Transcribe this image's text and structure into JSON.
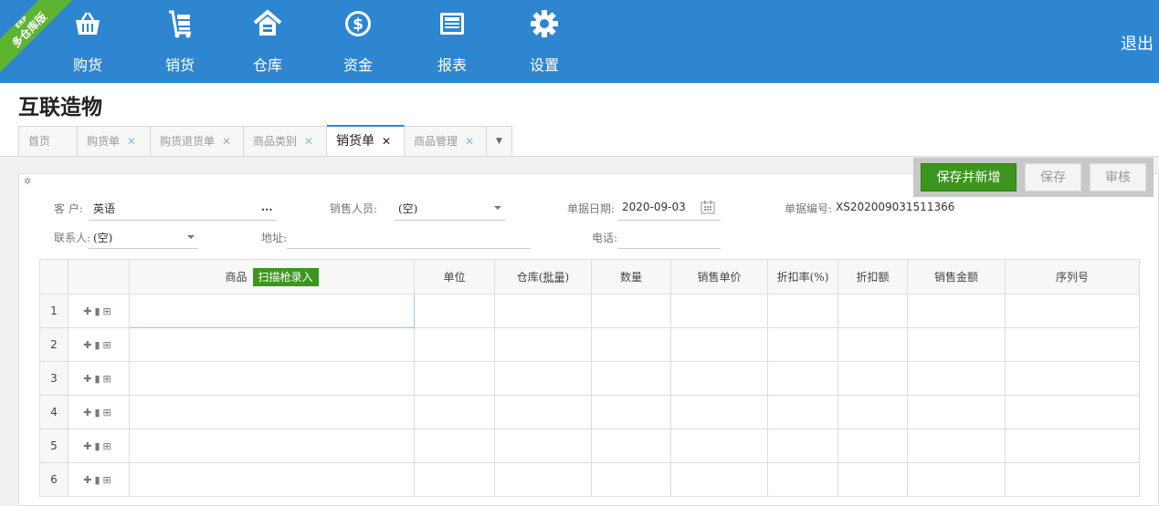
{
  "ribbon": {
    "line1": "ERP",
    "line2": "多仓库版"
  },
  "nav": [
    {
      "label": "购货",
      "icon": "shopping-basket-icon"
    },
    {
      "label": "销货",
      "icon": "cart-dolly-icon"
    },
    {
      "label": "仓库",
      "icon": "warehouse-icon"
    },
    {
      "label": "资金",
      "icon": "dollar-icon"
    },
    {
      "label": "报表",
      "icon": "report-icon"
    },
    {
      "label": "设置",
      "icon": "gear-icon"
    }
  ],
  "logout": "退出",
  "company": "互联造物",
  "tabs": [
    {
      "label": "首页"
    },
    {
      "label": "购货单"
    },
    {
      "label": "购货退货单"
    },
    {
      "label": "商品类别"
    },
    {
      "label": "销货单"
    },
    {
      "label": "商品管理"
    }
  ],
  "actions": {
    "save_new": "保存并新增",
    "save": "保存",
    "audit": "审核"
  },
  "form": {
    "customer_label": "客 户:",
    "customer_value": "英语",
    "customer_more": "...",
    "sales_label": "销售人员:",
    "sales_value": "(空)",
    "date_label": "单据日期:",
    "date_value": "2020-09-03",
    "no_label": "单据编号:",
    "no_value": "XS202009031511366",
    "contact_label": "联系人:",
    "contact_value": "(空)",
    "address_label": "地址:",
    "phone_label": "电话:"
  },
  "grid": {
    "headers": {
      "product": "商品",
      "scan": "扫描枪录入",
      "unit": "单位",
      "warehouse": "仓库(",
      "batch": "批量",
      "warehouse_close": ")",
      "qty": "数量",
      "price": "销售单价",
      "rate": "折扣率(%)",
      "discount": "折扣额",
      "amount": "销售金额",
      "serial": "序列号"
    },
    "rows": [
      "1",
      "2",
      "3",
      "4",
      "5",
      "6"
    ]
  }
}
